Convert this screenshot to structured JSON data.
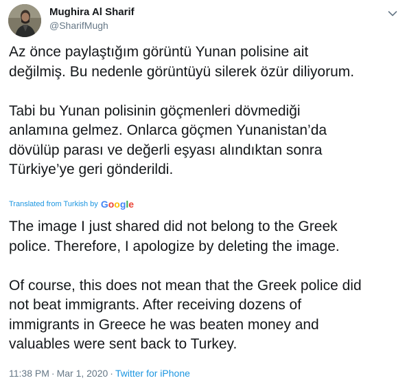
{
  "user": {
    "display_name": "Mughira Al Sharif",
    "handle": "@SharifMugh"
  },
  "tweet": {
    "original_text": "Az önce paylaştığım görüntü Yunan polisine ait\ndeğilmiş. Bu nedenle görüntüyü silerek özür diliyorum.\n\nTabi bu Yunan polisinin göçmenleri dövmediği\nanlamına gelmez. Onlarca göçmen Yunanistan’da\ndövülüp parası ve değerli eşyası alındıktan sonra\nTürkiye’ye geri gönderildi.",
    "translated_label": "Translated from Turkish by",
    "translation_provider": "Google",
    "translated_text": "The image I just shared did not belong to the Greek\npolice. Therefore, I apologize by deleting the image.\n\n Of course, this does not mean that the Greek police did\nnot beat immigrants. After receiving dozens of\nimmigrants in Greece he was beaten money and\nvaluables were sent back to Turkey.",
    "time": "11:38 PM",
    "separator": "·",
    "date": "Mar 1, 2020",
    "source": "Twitter for iPhone"
  },
  "icons": {
    "avatar": "user-avatar-photo",
    "caret": "chevron-down-icon"
  },
  "colors": {
    "text": "#14171a",
    "secondary": "#657786",
    "link": "#1b95e0",
    "google_blue": "#4285F4",
    "google_red": "#EA4335",
    "google_yellow": "#FBBC05",
    "google_green": "#34A853"
  }
}
